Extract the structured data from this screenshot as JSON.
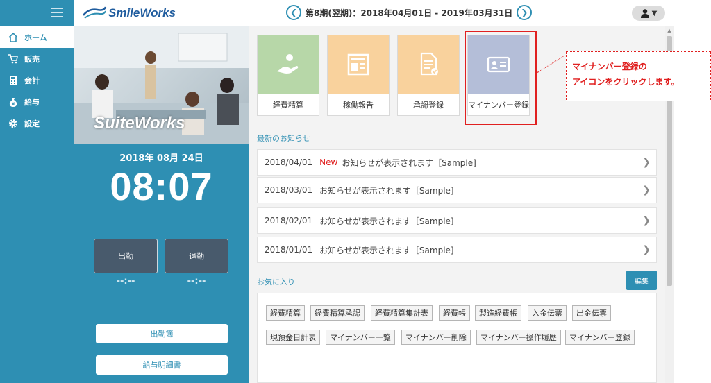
{
  "header": {
    "logo_text": "SmileWorks",
    "period_label": "第8期(翌期)：2018年04月01日 - 2019年03月31日",
    "prev_icon": "chevron-left-icon",
    "next_icon": "chevron-right-icon",
    "user_icon": "user-icon"
  },
  "sidebar": {
    "items": [
      {
        "label": "ホーム",
        "icon": "home-icon"
      },
      {
        "label": "販売",
        "icon": "cart-icon"
      },
      {
        "label": "会計",
        "icon": "calculator-icon"
      },
      {
        "label": "給与",
        "icon": "money-bag-icon"
      },
      {
        "label": "設定",
        "icon": "gear-icon"
      }
    ]
  },
  "dashboard": {
    "brand": "SuiteWorks",
    "date": "2018年 08月 24日",
    "time": "08:07",
    "clock_in_label": "出勤",
    "clock_out_label": "退勤",
    "clock_in_time": "--:--",
    "clock_out_time": "--:--",
    "attendance_button": "出勤簿",
    "payslip_button": "給与明細書"
  },
  "tiles": [
    {
      "label": "経費精算",
      "color": "#b7d7a8"
    },
    {
      "label": "稼働報告",
      "color": "#f9d29d"
    },
    {
      "label": "承認登録",
      "color": "#f9d29d"
    },
    {
      "label": "マイナンバー登録",
      "color": "#b4bed8"
    }
  ],
  "news": {
    "title": "最新のお知らせ",
    "items": [
      {
        "date": "2018/04/01",
        "badge": "New",
        "text": "お知らせが表示されます［Sample]"
      },
      {
        "date": "2018/03/01",
        "badge": "",
        "text": "お知らせが表示されます［Sample]"
      },
      {
        "date": "2018/02/01",
        "badge": "",
        "text": "お知らせが表示されます［Sample]"
      },
      {
        "date": "2018/01/01",
        "badge": "",
        "text": "お知らせが表示されます［Sample]"
      }
    ]
  },
  "favorites": {
    "title": "お気に入り",
    "edit_label": "編集",
    "items": [
      "経費精算",
      "経費精算承認",
      "経費精算集計表",
      "経費帳",
      "製造経費帳",
      "入金伝票",
      "出金伝票",
      "現預金日計表",
      "マイナンバー一覧",
      "マイナンバー削除",
      "マイナンバー操作履歴",
      "マイナンバー登録"
    ]
  },
  "callout": {
    "line1": "マイナンバー登録の",
    "line2": "アイコンをクリックします。"
  },
  "colors": {
    "accent": "#2e8fb3",
    "highlight": "#e02020",
    "new_badge": "#e02020"
  }
}
